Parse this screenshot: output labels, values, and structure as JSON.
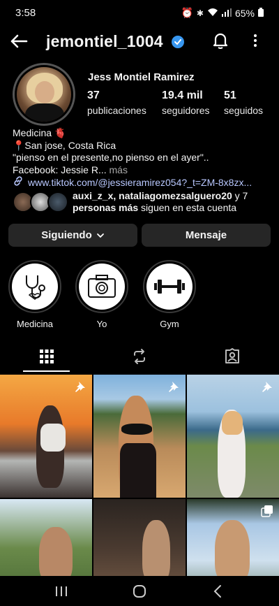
{
  "status_bar": {
    "time": "3:58",
    "battery": "65%",
    "icons": [
      "alarm-icon",
      "bluetooth-icon",
      "wifi-icon",
      "signal-icon",
      "battery-icon"
    ]
  },
  "header": {
    "username": "jemontiel_1004",
    "verified": true,
    "icons": [
      "back-arrow-icon",
      "verified-badge-icon",
      "bell-icon",
      "more-vertical-icon"
    ]
  },
  "profile": {
    "full_name": "Jess Montiel Ramirez",
    "stats": [
      {
        "value": "37",
        "label": "publicaciones"
      },
      {
        "value": "19.4 mil",
        "label": "seguidores"
      },
      {
        "value": "51",
        "label": "seguidos"
      }
    ],
    "bio": {
      "line1": "Medicina 🫀",
      "line2": "📍San jose, Costa Rica",
      "line3": "\"pienso en el presente,no pienso en el ayer\"..",
      "line4": "Facebook: Jessie R...",
      "more": " más"
    },
    "link": "www.tiktok.com/@jessieramirez054?_t=ZM-8x8zx...",
    "followed_by": {
      "names": "auxi_z_x, nataliagomezsalguero20",
      "connector": " y 7",
      "others": "personas más",
      "suffix": " siguen en esta cuenta"
    }
  },
  "actions": {
    "following": "Siguiendo",
    "message": "Mensaje"
  },
  "highlights": [
    {
      "label": "Medicina",
      "icon": "stethoscope-icon"
    },
    {
      "label": "Yo",
      "icon": "camera-icon"
    },
    {
      "label": "Gym",
      "icon": "dumbbell-icon"
    }
  ],
  "tabs": [
    {
      "name": "grid",
      "icon": "grid-icon",
      "active": true
    },
    {
      "name": "reels",
      "icon": "repost-icon",
      "active": false
    },
    {
      "name": "tagged",
      "icon": "tagged-person-icon",
      "active": false
    }
  ],
  "colors": {
    "background": "#000000",
    "button": "#262626",
    "link": "#b9c8ff",
    "verified": "#3897f0"
  }
}
